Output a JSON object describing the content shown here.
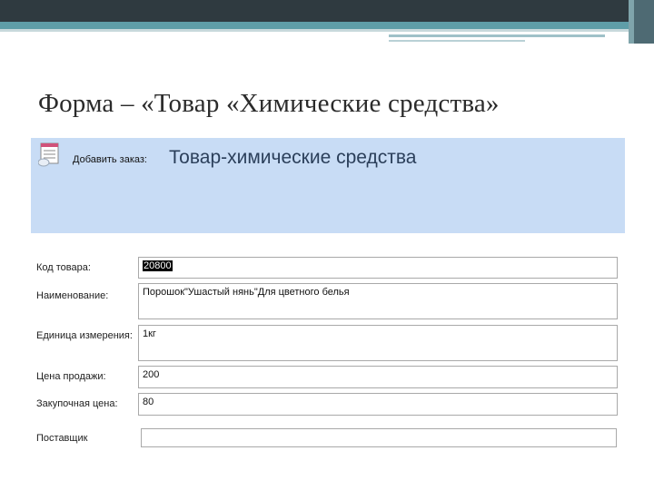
{
  "slide": {
    "title": "Форма – «Товар «Химические средства»"
  },
  "form": {
    "add_order_label": "Добавить заказ:",
    "caption": "Товар-химические средства",
    "fields": [
      {
        "label": "Код товара:",
        "value": "20800"
      },
      {
        "label": "Наименование:",
        "value": "Порошок\"Ушастый нянь\"Для цветного белья"
      },
      {
        "label": "Единица измерения:",
        "value": "1кг"
      },
      {
        "label": "Цена продажи:",
        "value": "200"
      },
      {
        "label": "Закупочная цена:",
        "value": "80"
      },
      {
        "label": "Поставщик",
        "value": ""
      }
    ]
  },
  "colors": {
    "header_bg": "#c8dcf5",
    "top_bar": "#2f3a40",
    "accent_teal": "#5f9ea8"
  }
}
